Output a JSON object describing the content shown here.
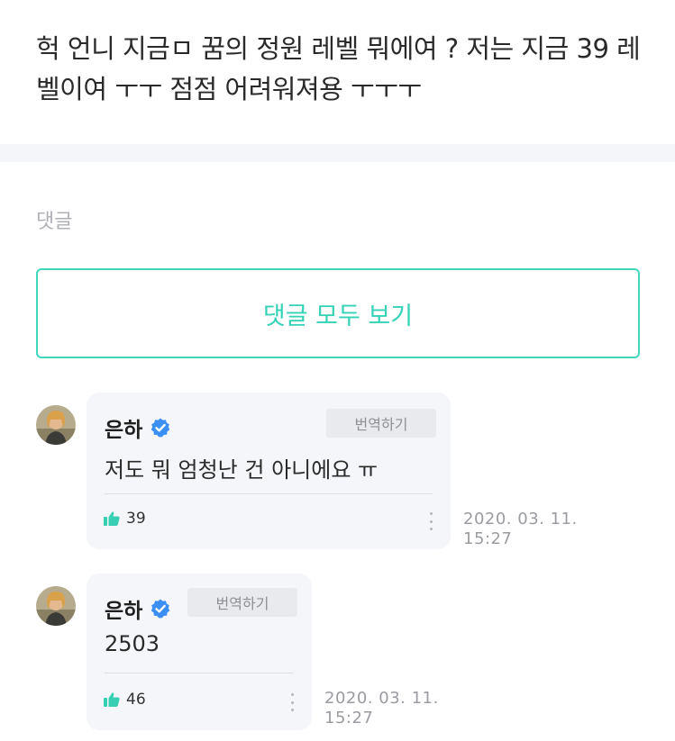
{
  "post": {
    "text": "헉 언니 지금ㅁ 꿈의 정원 레벨 뭐에여 ? 저는 지금 39 레벨이여 ㅜㅜ 점점 어려워져용 ㅜㅜㅜ"
  },
  "comments_section": {
    "label": "댓글",
    "view_all_label": "댓글 모두 보기"
  },
  "comments": [
    {
      "author": "은하",
      "verified": true,
      "translate_label": "번역하기",
      "text": "저도 뭐 엄청난 건 아니에요 ㅠ",
      "likes": "39",
      "date": "2020. 03. 11.",
      "time": "15:27"
    },
    {
      "author": "은하",
      "verified": true,
      "translate_label": "번역하기",
      "text": "2503",
      "likes": "46",
      "date": "2020. 03. 11.",
      "time": "15:27"
    }
  ],
  "colors": {
    "accent": "#34d2b6",
    "verified_badge": "#3b8ff5",
    "bubble_bg": "#f5f6f9",
    "divider_band": "#f5f6fa"
  },
  "icons": {
    "verified": "verified-check-icon",
    "like": "thumbs-up-icon",
    "more": "more-vertical-icon"
  }
}
